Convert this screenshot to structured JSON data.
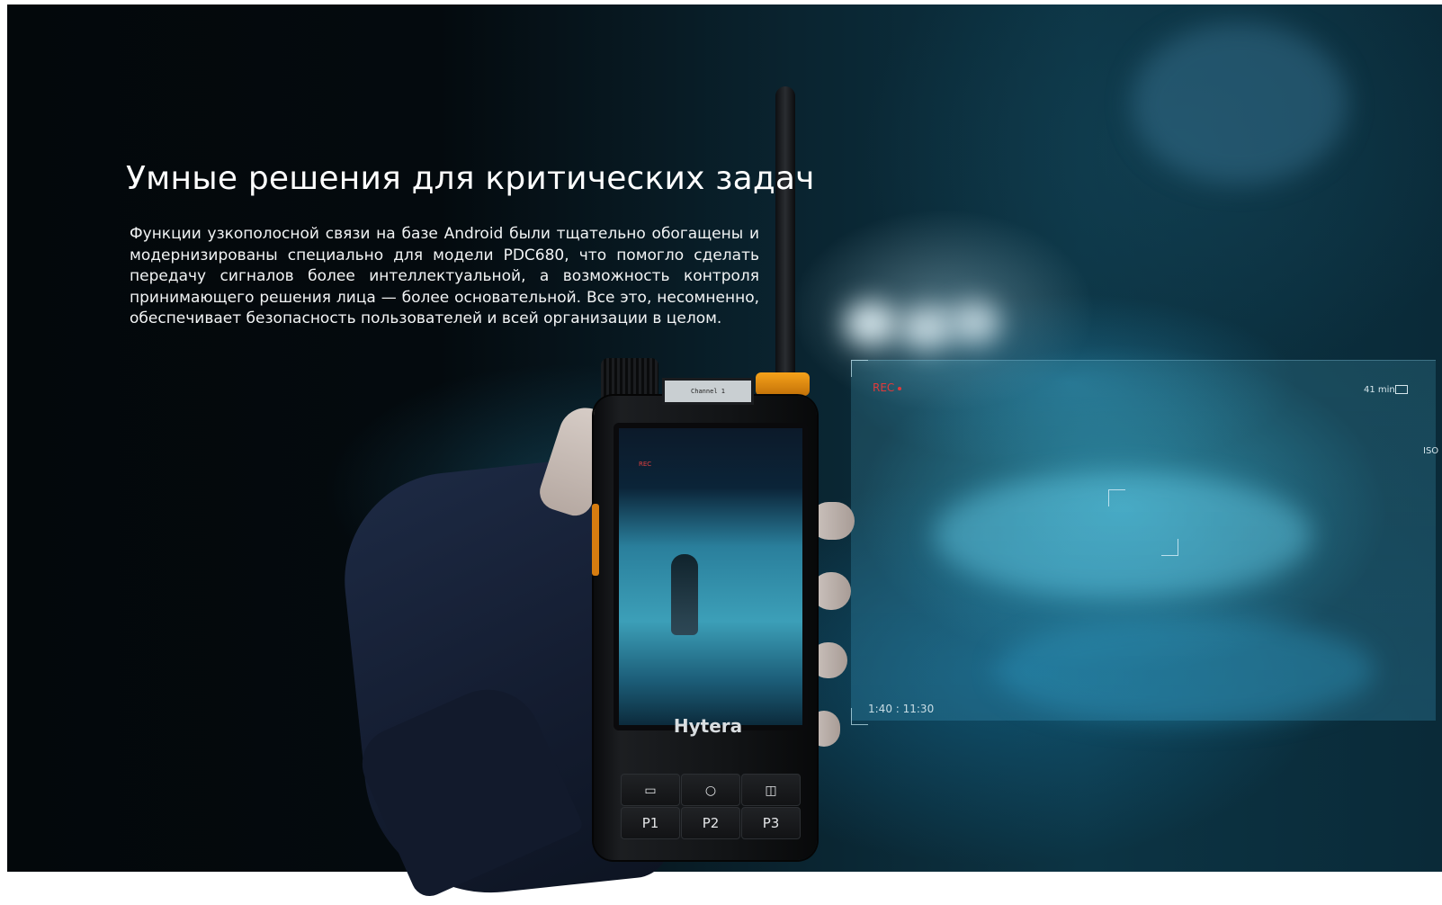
{
  "hero": {
    "headline": "Умные решения для критических задач",
    "description": "Функции узкополосной связи на базе Android были тщательно обогащены и модернизированы специально для модели PDC680, что помогло сделать передачу сигналов более интеллектуальной, а возможность контроля принимающего решения лица — более основательной. Все это, несомненно, обеспечивает безопасность пользователей и всей организации в целом."
  },
  "overlay": {
    "rec_label": "REC",
    "remaining": "41 min",
    "iso": "ISO",
    "timecode": "1:40 : 11:30"
  },
  "device": {
    "brand": "Hytera",
    "top_display_text": "Channel 1",
    "screen_rec_label": "REC",
    "keys": [
      {
        "label": "",
        "icon": "back-key-icon"
      },
      {
        "label": "",
        "icon": "home-circle-icon"
      },
      {
        "label": "",
        "icon": "menu-key-icon"
      },
      {
        "label": "P1"
      },
      {
        "label": "P2"
      },
      {
        "label": "P3"
      }
    ]
  },
  "colors": {
    "background_dark": "#03080b",
    "accent_cyan": "#3c9fb8",
    "antenna_orange": "#f6a21a",
    "rec_red": "#e23a3a",
    "text": "#ffffff"
  }
}
